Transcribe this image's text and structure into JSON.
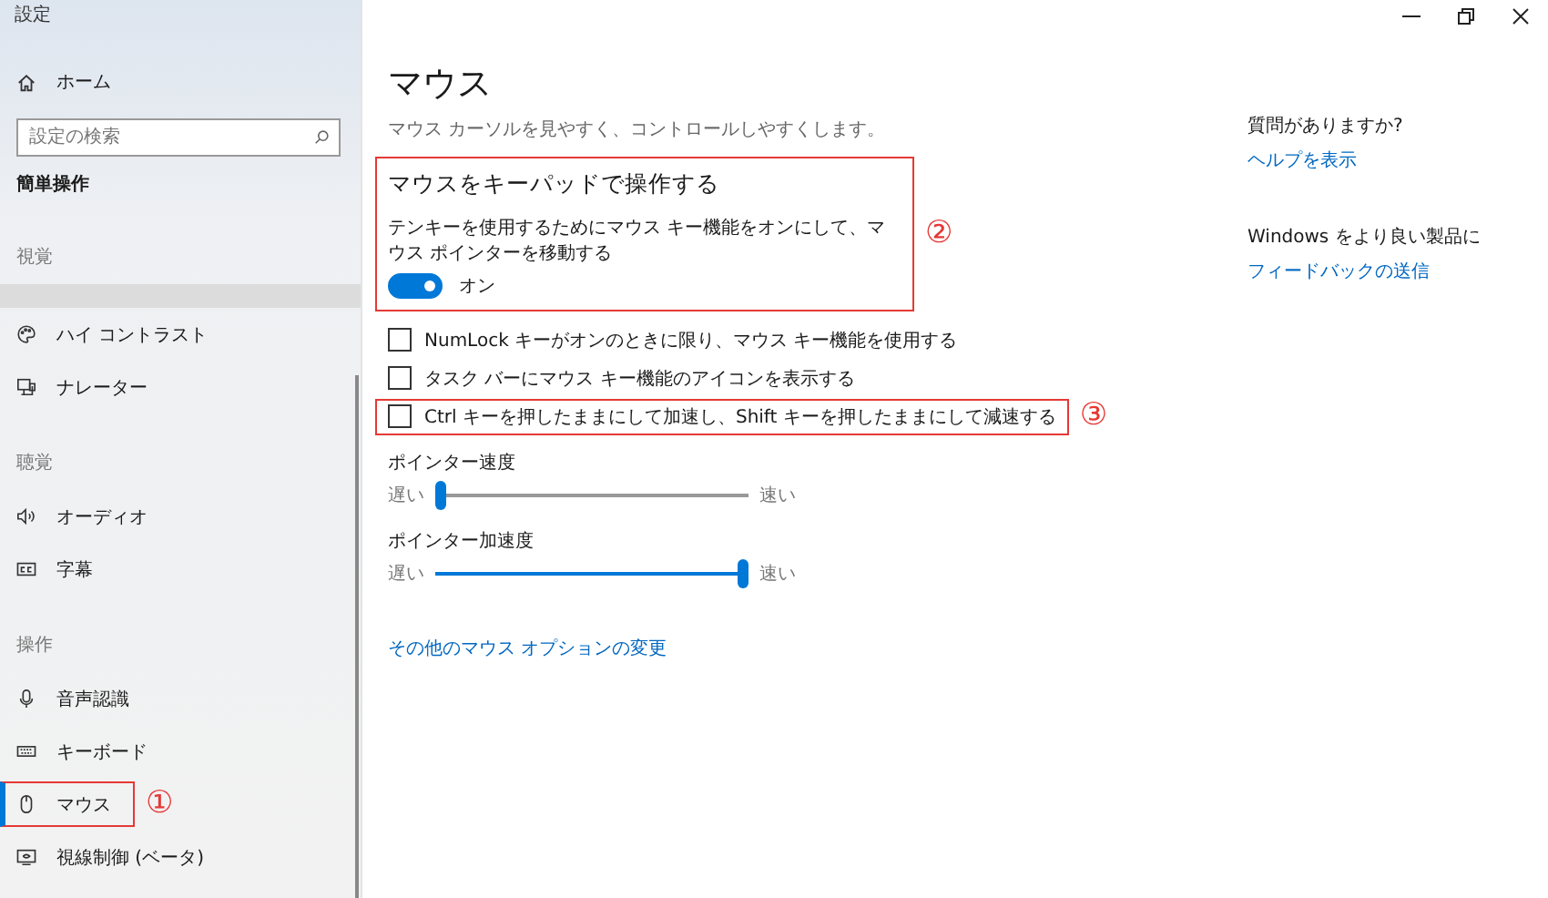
{
  "window": {
    "title": "設定"
  },
  "sidebar": {
    "home": {
      "label": "ホーム"
    },
    "search": {
      "placeholder": "設定の検索"
    },
    "section_title": "簡単操作",
    "groups": [
      {
        "label": "視覚",
        "scrolled_edge": true,
        "items": [
          {
            "label": "ハイ コントラスト",
            "kind": "palette",
            "selected": false
          },
          {
            "label": "ナレーター",
            "kind": "narrator",
            "selected": false
          }
        ]
      },
      {
        "label": "聴覚",
        "scrolled_edge": false,
        "items": [
          {
            "label": "オーディオ",
            "kind": "speaker",
            "selected": false
          },
          {
            "label": "字幕",
            "kind": "captions",
            "selected": false
          }
        ]
      },
      {
        "label": "操作",
        "scrolled_edge": false,
        "items": [
          {
            "label": "音声認識",
            "kind": "mic",
            "selected": false
          },
          {
            "label": "キーボード",
            "kind": "keyboard",
            "selected": false
          },
          {
            "label": "マウス",
            "kind": "mouse",
            "selected": true,
            "annotation": "①"
          },
          {
            "label": "視線制御 (ベータ)",
            "kind": "eye",
            "selected": false
          }
        ]
      }
    ]
  },
  "main": {
    "title": "マウス",
    "description": "マウス カーソルを見やすく、コントロールしやすくします。",
    "keypad_section": {
      "heading": "マウスをキーパッドで操作する",
      "description": "テンキーを使用するためにマウス キー機能をオンにして、マウス ポインターを移動する",
      "toggle": {
        "on": true,
        "label": "オン"
      },
      "annotation": "②"
    },
    "checkboxes": [
      {
        "label": "NumLock キーがオンのときに限り、マウス キー機能を使用する",
        "checked": false
      },
      {
        "label": "タスク バーにマウス キー機能のアイコンを表示する",
        "checked": false
      },
      {
        "label": "Ctrl キーを押したままにして加速し、Shift キーを押したままにして減速する",
        "checked": false,
        "annotation": "③"
      }
    ],
    "sliders": [
      {
        "label": "ポインター速度",
        "min_label": "遅い",
        "max_label": "速い",
        "level": 0
      },
      {
        "label": "ポインター加速度",
        "min_label": "遅い",
        "max_label": "速い",
        "level": 1
      }
    ],
    "link": "その他のマウス オプションの変更"
  },
  "help": [
    {
      "question": "質問がありますか?",
      "link": "ヘルプを表示"
    },
    {
      "question": "Windows をより良い製品に",
      "link": "フィードバックの送信"
    }
  ]
}
